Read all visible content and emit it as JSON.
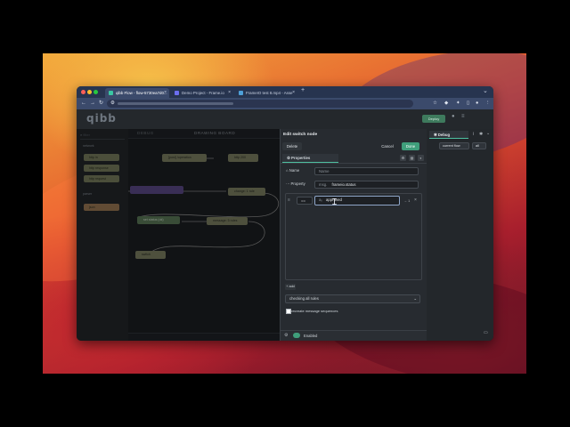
{
  "browser": {
    "tabs": [
      {
        "title": "qibb Flow - flow-5730ea7d0..."
      },
      {
        "title": "Demo Project - Frame.io"
      },
      {
        "title": "FrameIO test 8.mp4 - Asse"
      }
    ],
    "new_tab": "+",
    "nav": {
      "back": "←",
      "forward": "→",
      "reload": "↻"
    }
  },
  "app": {
    "logo": "qibb",
    "deploy_label": "Deploy"
  },
  "palette": {
    "search": "filter",
    "categories": [
      "network",
      "parser"
    ],
    "network_nodes": [
      "http in",
      "http response",
      "http request"
    ],
    "parser_nodes": [
      "json"
    ]
  },
  "workspace": {
    "tabs": [
      "DEBUG",
      "DRAWING BOARD"
    ],
    "nodes": [
      "[post] /operation",
      "http 200",
      "change: 1 rule",
      "set status (ok)",
      "message: 5 rules",
      "switch"
    ]
  },
  "tray": {
    "title": "Edit switch node",
    "delete_label": "Delete",
    "cancel_label": "Cancel",
    "done_label": "Done",
    "properties_tab": "Properties",
    "name_label": "Name",
    "name_value": "Name",
    "property_label": "Property",
    "property_type": "msg.",
    "property_value": "frameio.status",
    "rule": {
      "operator": "==",
      "type": "aₓ",
      "value": "approved",
      "output": "→ 1"
    },
    "add_label": "+ add",
    "mode_select": "checking all rules",
    "recreate_label": "recreate message sequences",
    "enabled_label": "Enabled"
  },
  "sidebar": {
    "debug_tab": "Debug",
    "filter_select": "current flow",
    "level_select": "all"
  },
  "colors": {
    "accent": "#4ec0a0",
    "done_button": "#3f9e7b",
    "delete_button": "#3a3f45"
  }
}
